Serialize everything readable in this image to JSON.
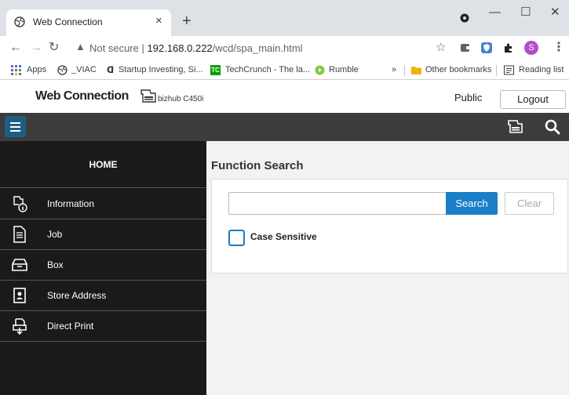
{
  "browser": {
    "tab_title": "Web Connection",
    "new_tab": "+",
    "url_warning": "Not secure",
    "url_separator": "|",
    "url_host": "192.168.0.222",
    "url_path": "/wcd/spa_main.html",
    "profile_initial": "S",
    "window_controls": {
      "minimize": "—",
      "maximize": "☐",
      "close": "✕"
    }
  },
  "bookmarks": {
    "items": [
      "Apps",
      "_VIAC",
      "Startup Investing, Si...",
      "TechCrunch - The la...",
      "Rumble"
    ],
    "overflow": "»",
    "other": "Other bookmarks",
    "reading_list": "Reading list"
  },
  "app": {
    "brand": "Web Connection",
    "model": "bizhub C450i",
    "user": "Public",
    "logout_label": "Logout"
  },
  "sidebar": {
    "home_label": "HOME",
    "items": [
      {
        "label": "Information",
        "icon": "information-icon"
      },
      {
        "label": "Job",
        "icon": "job-icon"
      },
      {
        "label": "Box",
        "icon": "box-icon"
      },
      {
        "label": "Store Address",
        "icon": "store-address-icon"
      },
      {
        "label": "Direct Print",
        "icon": "direct-print-icon"
      }
    ]
  },
  "content": {
    "title": "Function Search",
    "search_value": "",
    "search_placeholder": "",
    "search_label": "Search",
    "clear_label": "Clear",
    "case_sensitive_label": "Case Sensitive",
    "case_sensitive_checked": false
  },
  "colors": {
    "accent": "#1a7ec8",
    "hamburger_bg": "#1d5f82",
    "topbar": "#3c3c3c",
    "sidebar": "#1a1a1a"
  }
}
